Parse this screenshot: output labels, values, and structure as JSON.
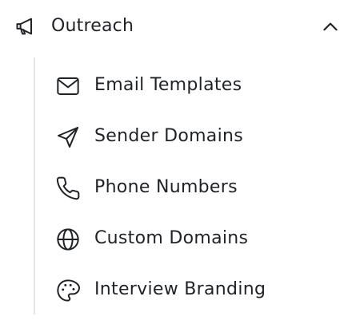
{
  "section": {
    "title": "Outreach",
    "icon": "megaphone-icon",
    "expanded": true,
    "toggle_icon": "chevron-up-icon"
  },
  "items": [
    {
      "label": "Email Templates",
      "icon": "mail-icon"
    },
    {
      "label": "Sender Domains",
      "icon": "send-icon"
    },
    {
      "label": "Phone Numbers",
      "icon": "phone-icon"
    },
    {
      "label": "Custom Domains",
      "icon": "globe-icon"
    },
    {
      "label": "Interview Branding",
      "icon": "palette-icon"
    }
  ],
  "colors": {
    "text": "#1f2328",
    "guide_line": "#e3e5e8",
    "background": "#ffffff"
  }
}
